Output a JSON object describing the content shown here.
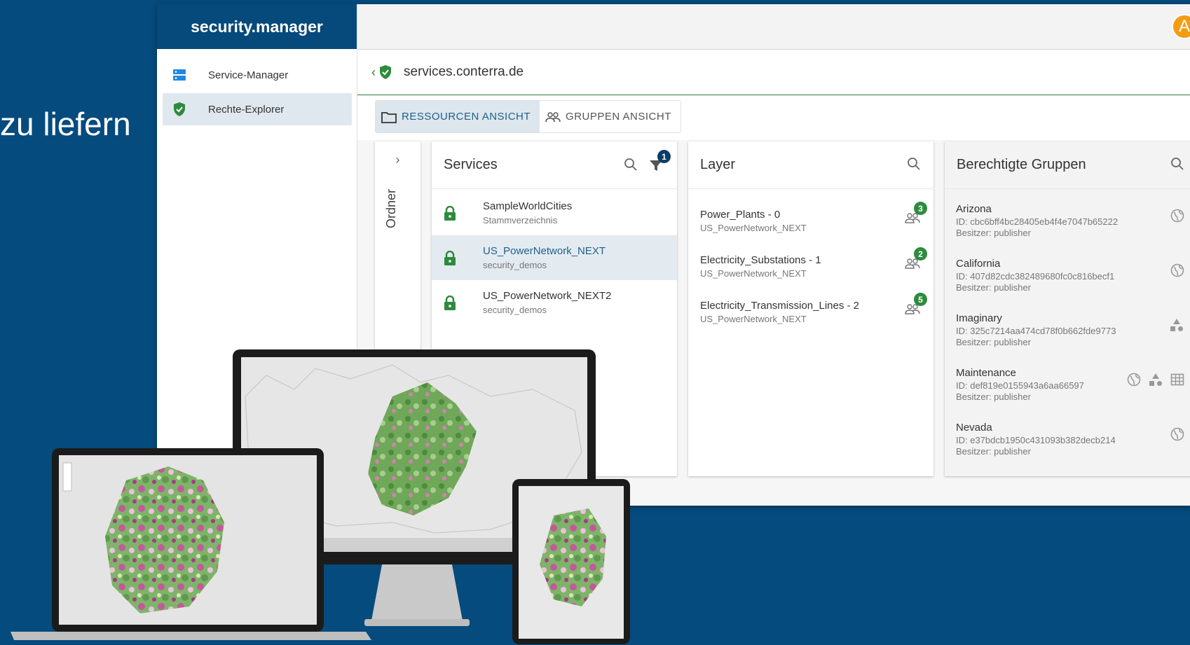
{
  "slide": {
    "text": "zu liefern"
  },
  "app": {
    "brand": "security.manager",
    "avatar_letter": "A",
    "nav": [
      {
        "label": "Service-Manager",
        "icon": "server-icon"
      },
      {
        "label": "Rechte-Explorer",
        "icon": "shield-icon"
      }
    ],
    "url": "services.conterra.de",
    "views": [
      {
        "label": "RESSOURCEN ANSICHT",
        "active": true,
        "icon": "folder-icon"
      },
      {
        "label": "GRUPPEN ANSICHT",
        "active": false,
        "icon": "groups-icon"
      }
    ],
    "folder_label": "Ordner",
    "services": {
      "title": "Services",
      "filter_count": "1",
      "items": [
        {
          "title": "SampleWorldCities",
          "sub": "Stammverzeichnis",
          "selected": false
        },
        {
          "title": "US_PowerNetwork_NEXT",
          "sub": "security_demos",
          "selected": true
        },
        {
          "title": "US_PowerNetwork_NEXT2",
          "sub": "security_demos",
          "selected": false
        }
      ]
    },
    "layer": {
      "title": "Layer",
      "items": [
        {
          "title": "Power_Plants - 0",
          "sub": "US_PowerNetwork_NEXT",
          "count": "3"
        },
        {
          "title": "Electricity_Substations - 1",
          "sub": "US_PowerNetwork_NEXT",
          "count": "2"
        },
        {
          "title": "Electricity_Transmission_Lines - 2",
          "sub": "US_PowerNetwork_NEXT",
          "count": "5"
        }
      ]
    },
    "groups": {
      "title": "Berechtigte Gruppen",
      "items": [
        {
          "title": "Arizona",
          "id": "ID: cbc6bff4bc28405eb4f4e7047b65222",
          "owner": "Besitzer: publisher"
        },
        {
          "title": "California",
          "id": "ID: 407d82cdc382489680fc0c816becf1",
          "owner": "Besitzer: publisher"
        },
        {
          "title": "Imaginary",
          "id": "ID: 325c7214aa474cd78f0b662fde9773",
          "owner": "Besitzer: publisher"
        },
        {
          "title": "Maintenance",
          "id": "ID: def819e0155943a6aa66597",
          "owner": "Besitzer: publisher"
        },
        {
          "title": "Nevada",
          "id": "ID: e37bdcb1950c431093b382decb214",
          "owner": "Besitzer: publisher"
        }
      ]
    }
  },
  "colors": {
    "brand": "#06497b",
    "background": "#054b7e",
    "lock_green": "#2e8b3d",
    "avatar": "#f39c12"
  }
}
